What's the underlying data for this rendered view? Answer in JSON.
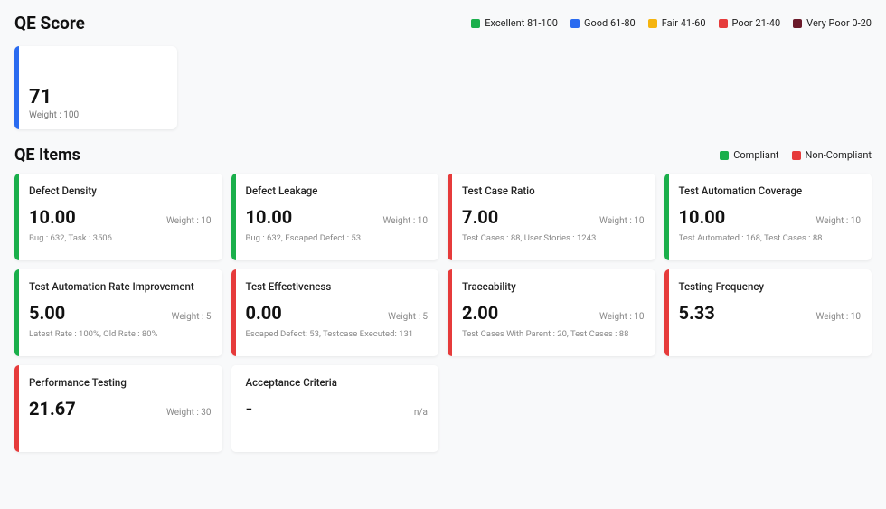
{
  "header": {
    "title": "QE Score",
    "legend": [
      {
        "label": "Excellent 81-100",
        "color": "#1aaf4b"
      },
      {
        "label": "Good 61-80",
        "color": "#2a6bf0"
      },
      {
        "label": "Fair 41-60",
        "color": "#f5b40f"
      },
      {
        "label": "Poor 21-40",
        "color": "#e63b3b"
      },
      {
        "label": "Very Poor 0-20",
        "color": "#6b1a2a"
      }
    ]
  },
  "score": {
    "value": "71",
    "weight_label": "Weight : 100",
    "stripe_color": "#2a6bf0"
  },
  "items_header": {
    "title": "QE Items",
    "legend": [
      {
        "label": "Compliant",
        "color": "#1aaf4b"
      },
      {
        "label": "Non-Compliant",
        "color": "#e63b3b"
      }
    ]
  },
  "items": [
    {
      "title": "Defect Density",
      "value": "10.00",
      "weight": "Weight : 10",
      "footer": "Bug : 632, Task : 3506",
      "stripe": "#1aaf4b"
    },
    {
      "title": "Defect Leakage",
      "value": "10.00",
      "weight": "Weight : 10",
      "footer": "Bug : 632, Escaped Defect : 53",
      "stripe": "#1aaf4b"
    },
    {
      "title": "Test Case Ratio",
      "value": "7.00",
      "weight": "Weight : 10",
      "footer": "Test Cases : 88, User Stories : 1243",
      "stripe": "#e63b3b"
    },
    {
      "title": "Test Automation Coverage",
      "value": "10.00",
      "weight": "Weight : 10",
      "footer": "Test Automated : 168, Test Cases : 88",
      "stripe": "#1aaf4b"
    },
    {
      "title": "Test Automation Rate Improvement",
      "value": "5.00",
      "weight": "Weight : 5",
      "footer": "Latest Rate : 100%, Old Rate : 80%",
      "stripe": "#1aaf4b"
    },
    {
      "title": "Test Effectiveness",
      "value": "0.00",
      "weight": "Weight : 5",
      "footer": "Escaped Defect: 53, Testcase Executed: 131",
      "stripe": "#e63b3b"
    },
    {
      "title": "Traceability",
      "value": "2.00",
      "weight": "Weight : 10",
      "footer": "Test Cases With Parent : 20, Test Cases : 88",
      "stripe": "#e63b3b"
    },
    {
      "title": "Testing Frequency",
      "value": "5.33",
      "weight": "Weight : 10",
      "footer": "",
      "stripe": "#e63b3b"
    },
    {
      "title": "Performance Testing",
      "value": "21.67",
      "weight": "Weight : 30",
      "footer": "",
      "stripe": "#e63b3b"
    },
    {
      "title": "Acceptance Criteria",
      "value": "-",
      "weight": "n/a",
      "footer": "",
      "stripe": "#ffffff"
    }
  ]
}
